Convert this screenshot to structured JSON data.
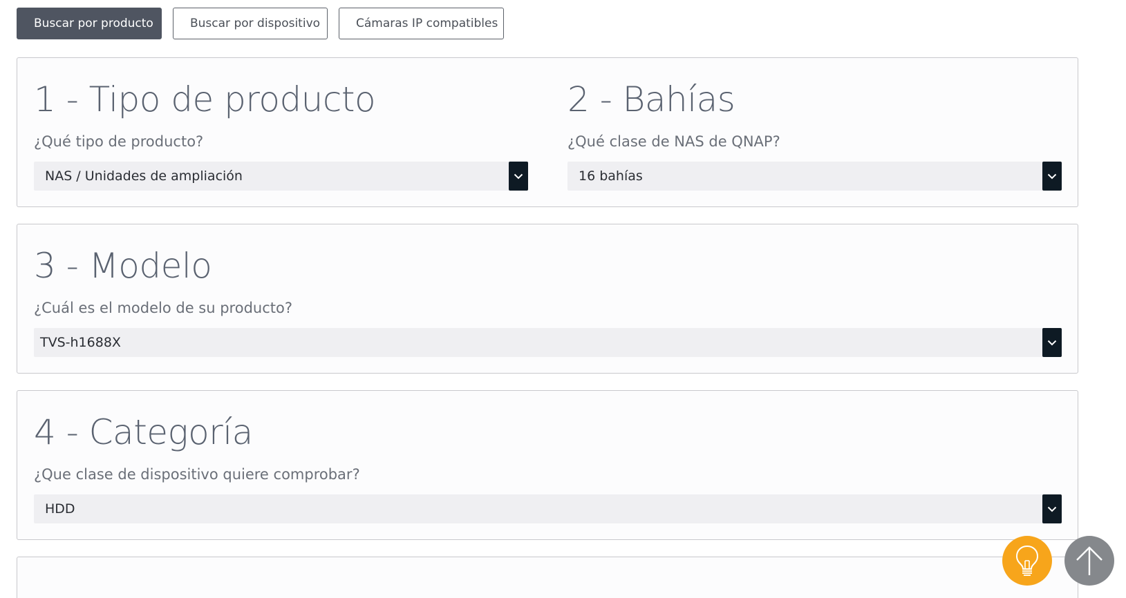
{
  "tabs": [
    {
      "label": "Buscar por producto",
      "active": true
    },
    {
      "label": "Buscar por dispositivo",
      "active": false
    },
    {
      "label": "Cámaras IP compatibles",
      "active": false
    }
  ],
  "steps": {
    "product_type": {
      "title": "1 - Tipo de producto",
      "question": "¿Qué tipo de producto?",
      "selected": "NAS / Unidades de ampliación"
    },
    "bays": {
      "title": "2 - Bahías",
      "question": "¿Qué clase de NAS de QNAP?",
      "selected": "16 bahías"
    },
    "model": {
      "title": "3 - Modelo",
      "question": "¿Cuál es el modelo de su producto?",
      "selected": "TVS-h1688X"
    },
    "category": {
      "title": "4 - Categoría",
      "question": "¿Que clase de dispositivo quiere comprobar?",
      "selected": "HDD"
    }
  },
  "icons": {
    "dropdown": "chevron-down-icon",
    "tip": "lightbulb-icon",
    "scroll_top": "arrow-up-icon"
  },
  "colors": {
    "active_tab": "#4f5561",
    "select_arrow": "#0e1a24",
    "tip_button": "#f7a51b",
    "scroll_top_button": "#85888c"
  }
}
